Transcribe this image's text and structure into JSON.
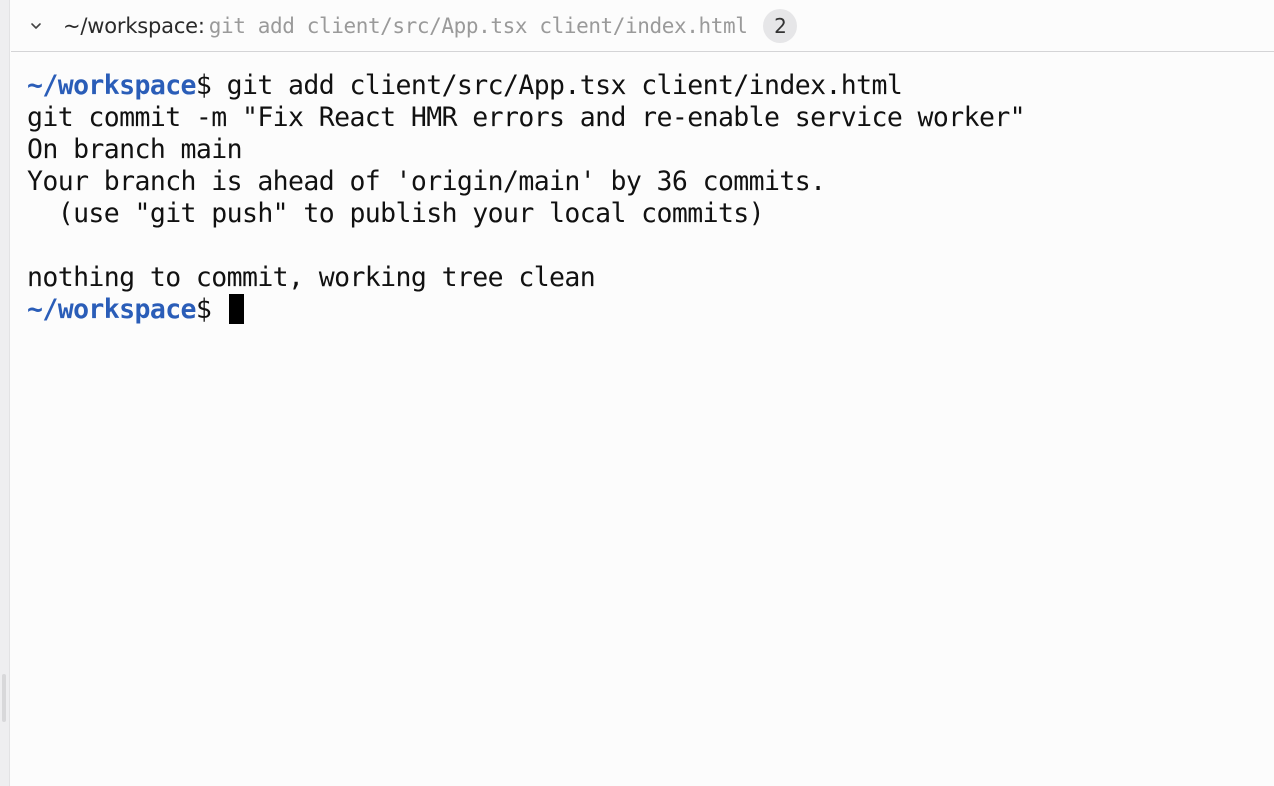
{
  "header": {
    "cwd": "~/workspace:",
    "command_preview": "git add client/src/App.tsx client/index.html",
    "count": "2",
    "chevron_icon": "chevron-down-icon"
  },
  "terminal": {
    "prompt": "~/workspace",
    "dollar": "$",
    "lines": [
      " git add client/src/App.tsx client/index.html",
      "git commit -m \"Fix React HMR errors and re-enable service worker\"",
      "On branch main",
      "Your branch is ahead of 'origin/main' by 36 commits.",
      "  (use \"git push\" to publish your local commits)",
      "",
      "nothing to commit, working tree clean"
    ],
    "final_prompt": "~/workspace",
    "final_dollar": "$ "
  },
  "colors": {
    "prompt": "#2a5db8",
    "text": "#111111",
    "muted": "#9a9a9a",
    "background": "#fcfcfc"
  }
}
